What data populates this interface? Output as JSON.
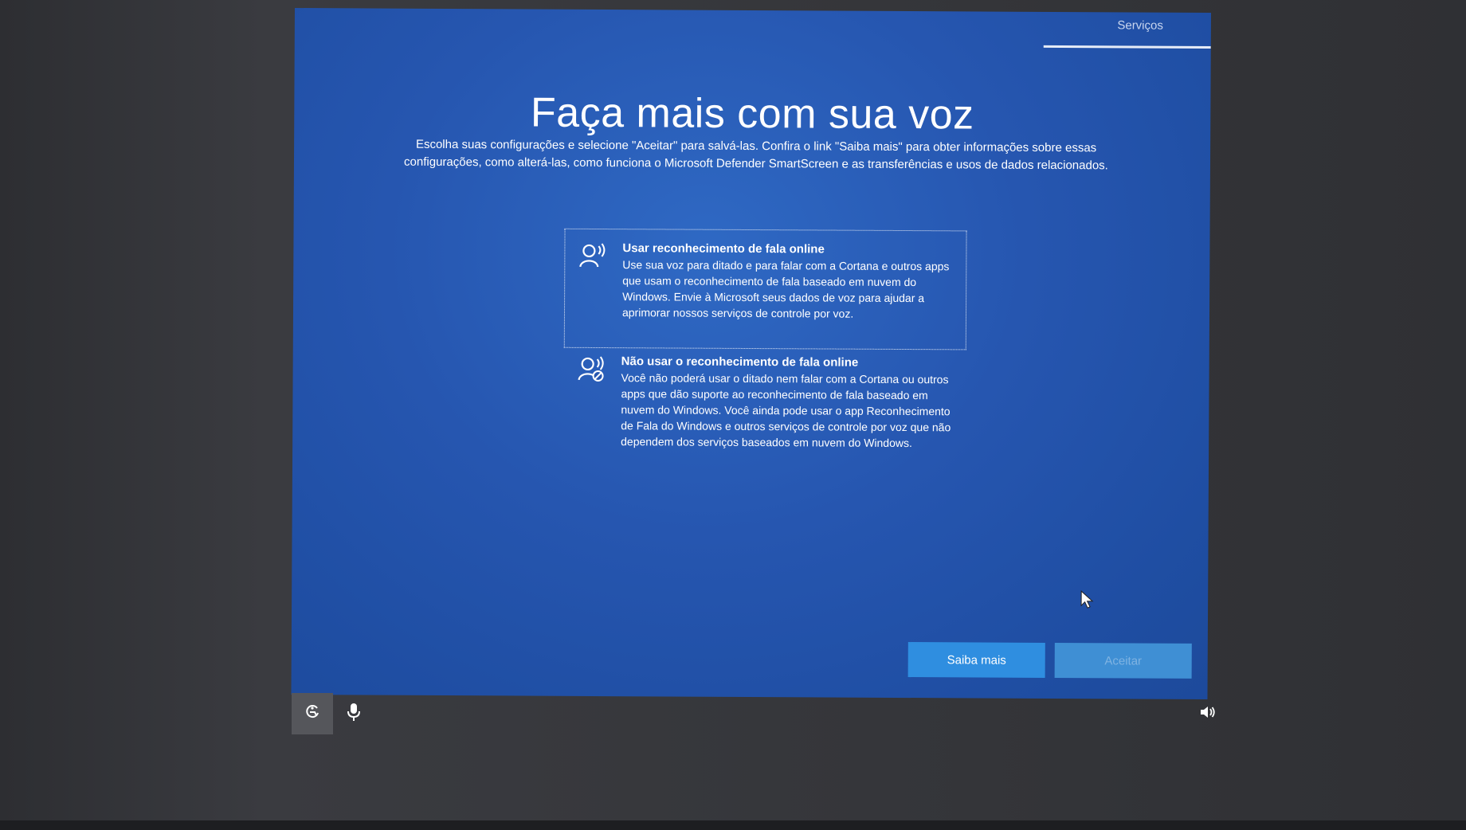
{
  "header": {
    "progress_label": "Serviços"
  },
  "main": {
    "title": "Faça mais com sua voz",
    "subtitle": "Escolha suas configurações e selecione \"Aceitar\" para salvá-las. Confira o link \"Saiba mais\" para obter informações sobre essas configurações, como alterá-las, como funciona o Microsoft Defender SmartScreen e as transferências e usos de dados relacionados."
  },
  "options": [
    {
      "icon": "speech-recognition-icon",
      "title": "Usar reconhecimento de fala online",
      "description": "Use sua voz para ditado e para falar com a Cortana e outros apps que usam o reconhecimento de fala baseado em nuvem do Windows. Envie à Microsoft seus dados de voz para ajudar a aprimorar nossos serviços de controle por voz.",
      "selected": true
    },
    {
      "icon": "speech-recognition-off-icon",
      "title": "Não usar o reconhecimento de fala online",
      "description": "Você não poderá usar o ditado nem falar com a Cortana ou outros apps que dão suporte ao reconhecimento de fala baseado em nuvem do Windows. Você ainda pode usar o app Reconhecimento de Fala do Windows e outros serviços de controle por voz que não dependem dos serviços baseados em nuvem do Windows.",
      "selected": false
    }
  ],
  "buttons": {
    "learn_more": "Saiba mais",
    "accept": "Aceitar",
    "accept_disabled": true
  },
  "taskbar": {
    "ease_of_access_icon": "ease-of-access-icon",
    "microphone_icon": "microphone-icon",
    "volume_icon": "volume-icon"
  },
  "colors": {
    "oobe_background": "#2656b0",
    "primary_button": "#2f8ee0",
    "disabled_button": "#3f8fd4",
    "progress_bar": "#e6ecf7"
  }
}
